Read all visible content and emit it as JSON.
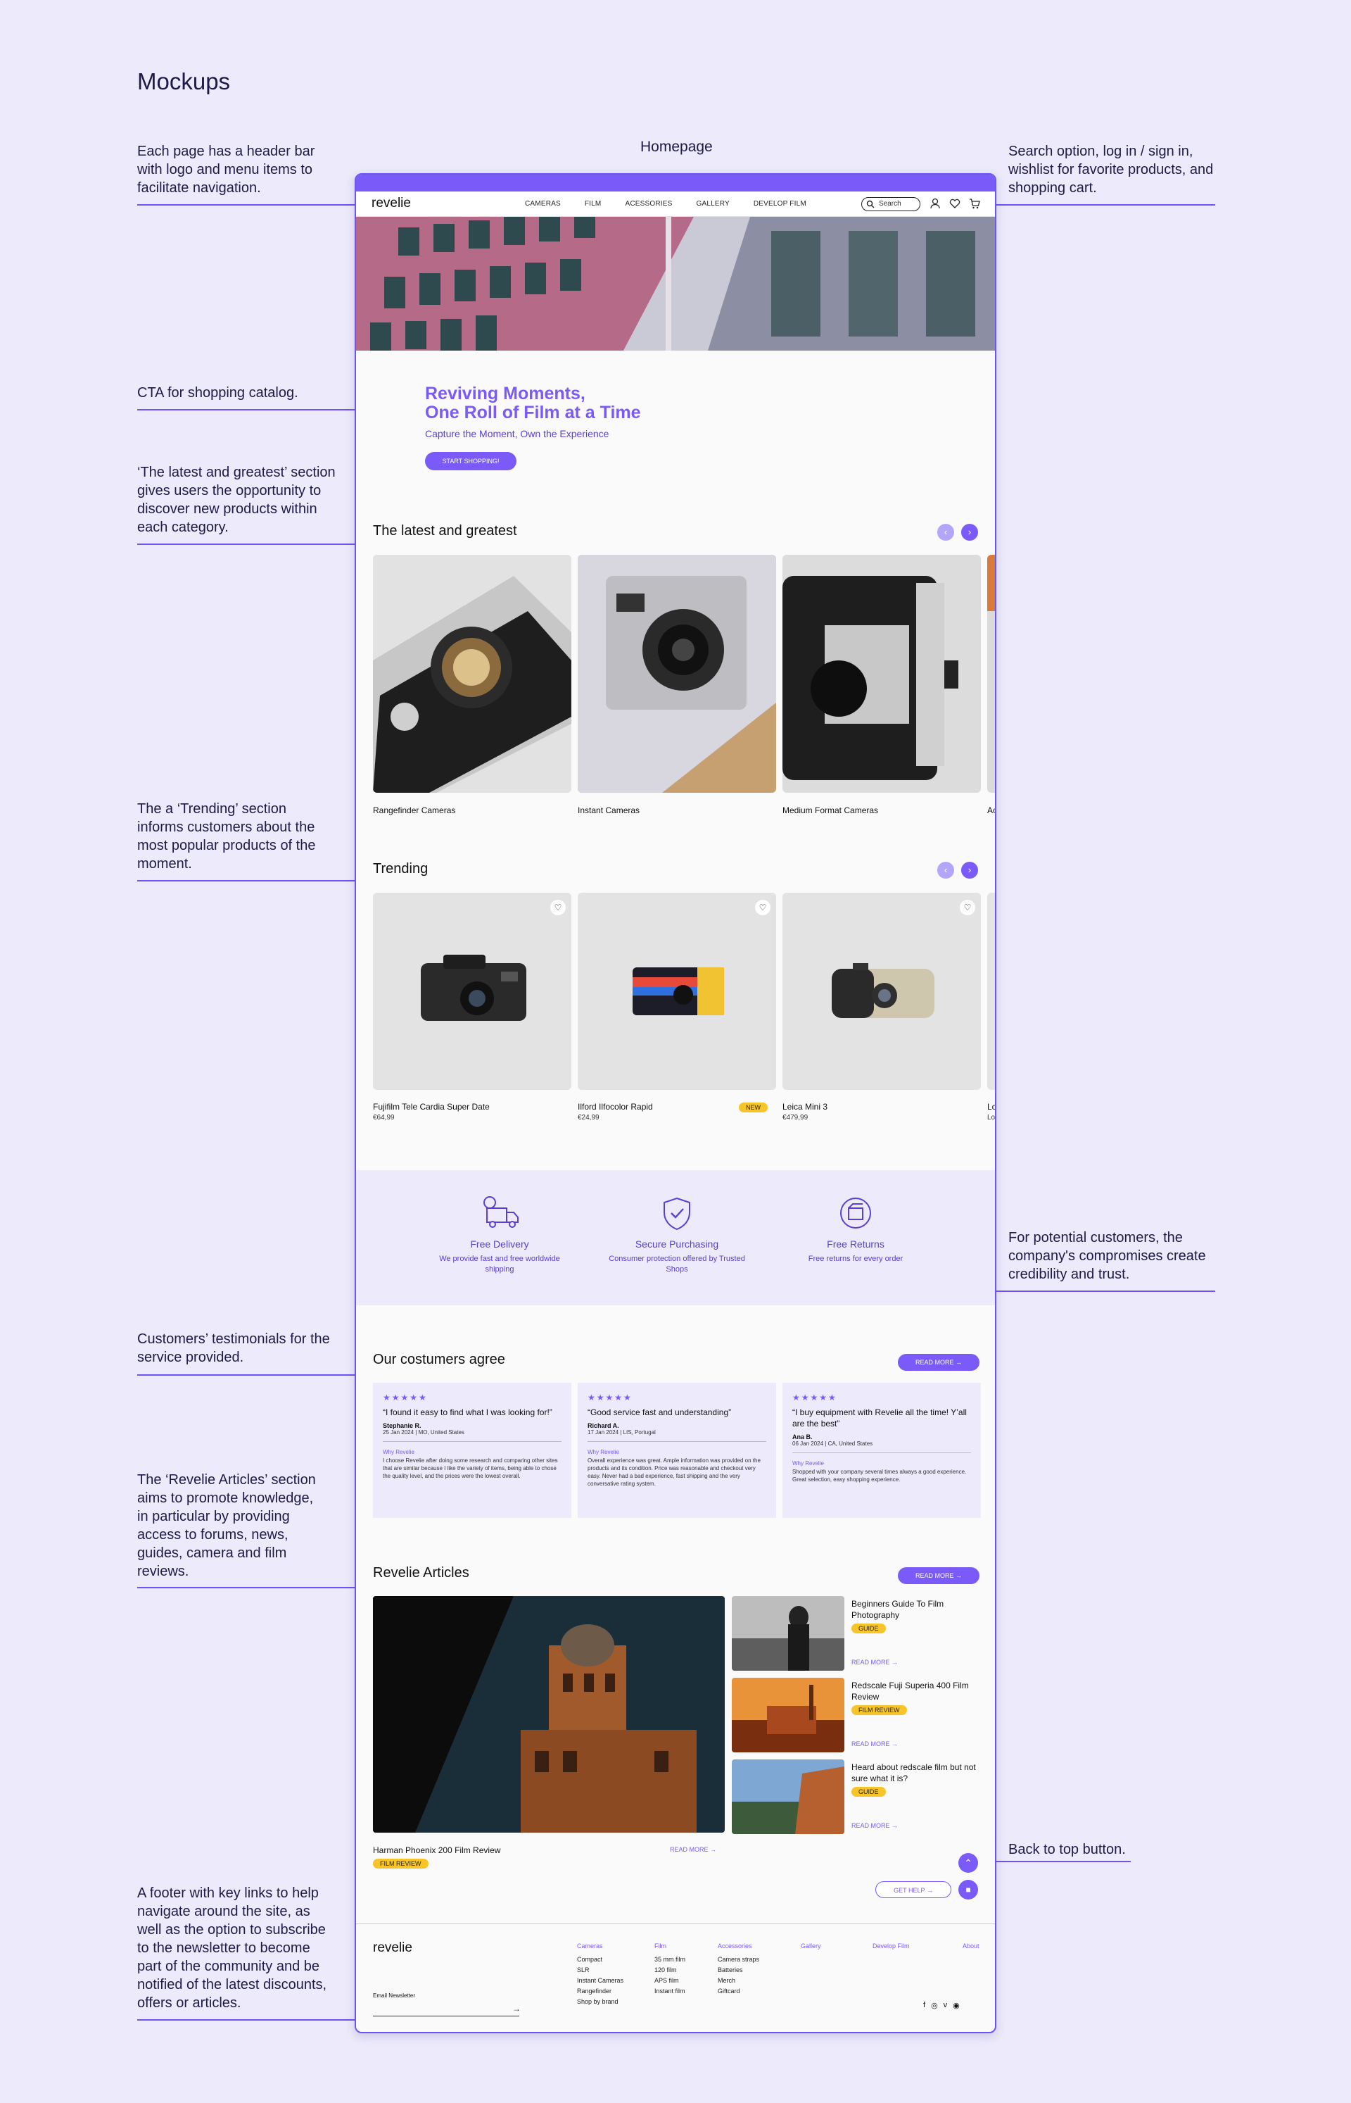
{
  "page_title": "Mockups",
  "section_label": "Homepage",
  "annotations": {
    "header": "Each page has a header bar with logo and menu items to facilitate navigation.",
    "search": "Search option, log in / sign in, wishlist for favorite products, and shopping cart.",
    "cta": "CTA for shopping catalog.",
    "latest": "‘The latest and greatest’ section gives users the opportunity to discover new products within each category.",
    "trending": "The a ‘Trending’ section informs customers about the most popular products of the moment.",
    "trust": "For potential customers, the company's compromises create credibility and trust.",
    "testimonials": "Customers’ testimonials for the service provided.",
    "articles": "The ‘Revelie Articles’ section aims to promote knowledge, in particular by providing access to forums, news, guides, camera and film reviews.",
    "back_to_top": "Back to top button.",
    "footer": "A footer with key links to help navigate around the site, as well as the option to subscribe to the newsletter to become part of the community and be notified of the latest discounts, offers or articles."
  },
  "header": {
    "logo": "revelie",
    "nav": [
      "CAMERAS",
      "FILM",
      "ACESSORIES",
      "GALLERY",
      "DEVELOP FILM"
    ],
    "search_placeholder": "Search"
  },
  "cta": {
    "title_line1": "Reviving Moments,",
    "title_line2": "One Roll of Film at a Time",
    "subtitle": "Capture the Moment, Own the Experience",
    "button": "START SHOPPING!"
  },
  "latest": {
    "title": "The latest and greatest",
    "items": [
      "Rangefinder Cameras",
      "Instant Cameras",
      "Medium Format Cameras",
      "Ac"
    ]
  },
  "trending": {
    "title": "Trending",
    "items": [
      {
        "name": "Fujifilm Tele Cardia Super Date",
        "price": "€64,99",
        "badge": ""
      },
      {
        "name": "Ilford Ilfocolor Rapid",
        "price": "€24,99",
        "badge": "NEW"
      },
      {
        "name": "Leica Mini 3",
        "price": "€479,99",
        "badge": ""
      },
      {
        "name": "Lo",
        "price": "Lo",
        "badge": ""
      }
    ]
  },
  "trust": [
    {
      "title": "Free Delivery",
      "desc": "We provide fast and free worldwide shipping",
      "icon": "truck-icon"
    },
    {
      "title": "Secure Purchasing",
      "desc": "Consumer protection offered by Trusted Shops",
      "icon": "shield-check-icon"
    },
    {
      "title": "Free Returns",
      "desc": "Free returns for every order",
      "icon": "return-box-icon"
    }
  ],
  "testimonials": {
    "title": "Our costumers agree",
    "read_more": "READ MORE",
    "items": [
      {
        "stars": "★★★★★",
        "quote": "“I found it easy to find what I was looking for!”",
        "name": "Stephanie R.",
        "meta": "25 Jan 2024 | MO, United States",
        "why": "Why Revelie",
        "body": "I choose Revelie after doing some research and comparing other sites that are similar because I like the variety of items, being able to chose the quality level, and the prices were the lowest overall."
      },
      {
        "stars": "★★★★★",
        "quote": "“Good service fast and understanding”",
        "name": "Richard A.",
        "meta": "17 Jan 2024 | LIS, Portugal",
        "why": "Why Revelie",
        "body": "Overall experience was great. Ample information was provided on the products and its condition. Price was reasonable and checkout very easy. Never had a bad experience, fast shipping and the very conversative rating system."
      },
      {
        "stars": "★★★★★",
        "quote": "“I buy equipment with Revelie all the time! Y’all are the best”",
        "name": "Ana B.",
        "meta": "06 Jan 2024 | CA, United States",
        "why": "Why Revelie",
        "body": "Shopped with your company several times always a good experience. Great selection, easy shopping experience."
      }
    ]
  },
  "articles": {
    "title": "Revelie Articles",
    "read_more": "READ MORE",
    "main": {
      "title": "Harman Phoenix 200 Film Review",
      "tag": "FILM REVIEW",
      "read_more": "READ MORE"
    },
    "side": [
      {
        "title": "Beginners Guide To Film Photography",
        "tag": "GUIDE",
        "read_more": "READ MORE"
      },
      {
        "title": "Redscale Fuji Superia 400 Film Review",
        "tag": "FILM REVIEW",
        "read_more": "READ MORE"
      },
      {
        "title": "Heard about redscale film but not sure what it is?",
        "tag": "GUIDE",
        "read_more": "READ MORE"
      }
    ],
    "get_help": "GET HELP"
  },
  "footer": {
    "logo": "revelie",
    "newsletter_label": "Email Newsletter",
    "columns": [
      {
        "head": "Cameras",
        "links": [
          "Compact",
          "SLR",
          "Instant Cameras",
          "Rangefinder",
          "Shop by brand"
        ]
      },
      {
        "head": "Film",
        "links": [
          "35 mm film",
          "120 film",
          "APS film",
          "Instant film"
        ]
      },
      {
        "head": "Accessories",
        "links": [
          "Camera straps",
          "Batteries",
          "Merch",
          "Giftcard"
        ]
      },
      {
        "head": "Gallery",
        "links": []
      },
      {
        "head": "Develop Film",
        "links": []
      },
      {
        "head": "About",
        "links": []
      }
    ],
    "social": [
      "f",
      "◎",
      "v",
      "◉"
    ]
  },
  "colors": {
    "accent": "#7A5AF8",
    "background": "#ECEAFB",
    "badge": "#F7C52A"
  }
}
